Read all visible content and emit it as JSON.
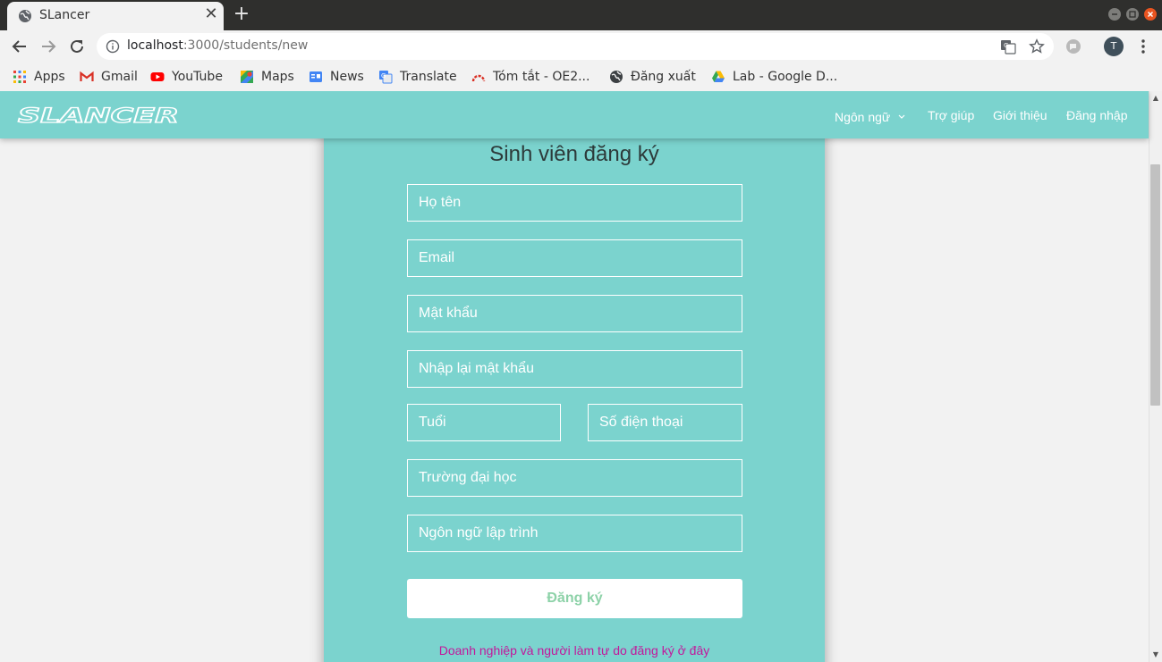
{
  "browser": {
    "tab_title": "SLancer",
    "tab_close": "✕",
    "new_tab": "+",
    "url_host": "localhost",
    "url_rest": ":3000/students/new",
    "avatar_letter": "T"
  },
  "bookmarks": [
    {
      "label": "Apps"
    },
    {
      "label": "Gmail"
    },
    {
      "label": "YouTube"
    },
    {
      "label": "Maps"
    },
    {
      "label": "News"
    },
    {
      "label": "Translate"
    },
    {
      "label": "Tóm tắt - OE2..."
    },
    {
      "label": "Đăng xuất"
    },
    {
      "label": "Lab - Google D..."
    }
  ],
  "navbar": {
    "brand": "SLANCER",
    "language": "Ngôn ngữ",
    "help": "Trợ giúp",
    "about": "Giới thiệu",
    "login": "Đăng nhập"
  },
  "form": {
    "title": "Sinh viên đăng ký",
    "name_placeholder": "Họ tên",
    "email_placeholder": "Email",
    "password_placeholder": "Mật khẩu",
    "confirm_placeholder": "Nhập lại mật khẩu",
    "age_placeholder": "Tuổi",
    "phone_placeholder": "Số điện thoại",
    "university_placeholder": "Trường đại học",
    "language_placeholder": "Ngôn ngữ lập trình",
    "submit_label": "Đăng ký",
    "business_link": "Doanh nghiệp và người làm tự do đăng ký ở đây"
  },
  "colors": {
    "accent": "#7bd3ce",
    "submit_text": "#8dd2a8",
    "link": "#c2189b"
  }
}
